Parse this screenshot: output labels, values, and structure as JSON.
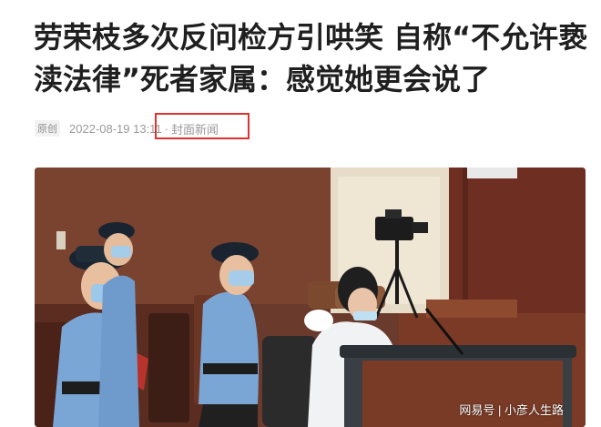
{
  "article": {
    "title": "劳荣枝多次反问检方引哄笑 自称“不允许亵渎法律”死者家属：感觉她更会说了",
    "tag": "原创",
    "date": "2022-08-19 13:11",
    "separator": "·",
    "source": "封面新闻"
  },
  "photo": {
    "watermark": "网易号 | 小彦人生路"
  },
  "colors": {
    "highlight_border": "#e03131",
    "title": "#1f1f1f",
    "meta": "#9a9a9a"
  }
}
